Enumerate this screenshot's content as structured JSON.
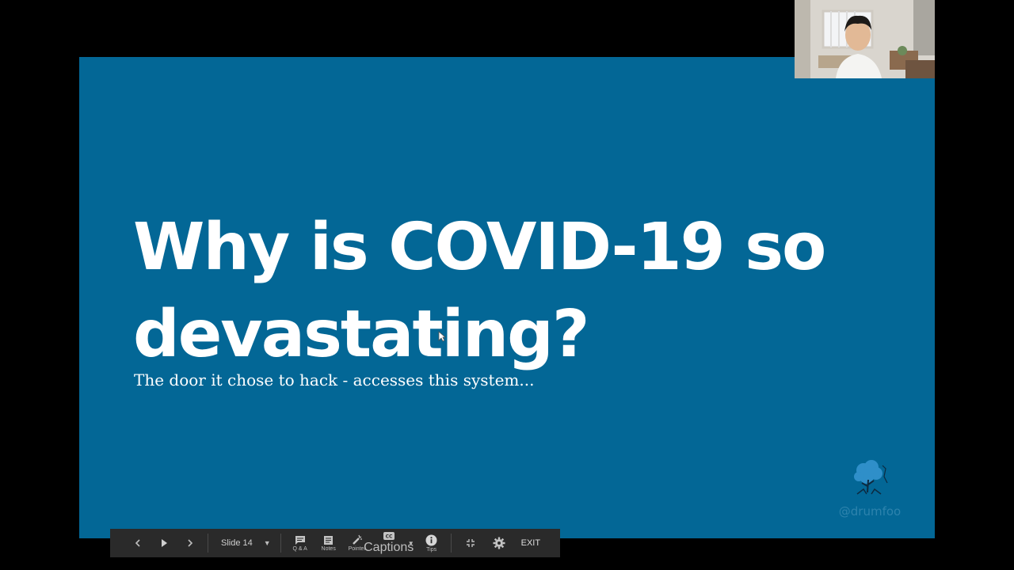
{
  "slide": {
    "title_line1": "Why is COVID-19 so",
    "title_line2": "devastating?",
    "subtitle": "The door it chose to hack - accesses this system...",
    "handle": "@drumfoo",
    "background_color": "#036796"
  },
  "toolbar": {
    "slide_label": "Slide 14",
    "qa_label": "Q & A",
    "notes_label": "Notes",
    "pointer_label": "Pointer",
    "captions_label": "Captions",
    "tips_label": "Tips",
    "exit_label": "EXIT"
  },
  "icons": {
    "prev": "chevron-left-icon",
    "play": "play-icon",
    "next": "chevron-right-icon",
    "qa": "chat-icon",
    "notes": "notes-icon",
    "pointer": "laser-pointer-icon",
    "captions": "cc-icon",
    "tips": "info-icon",
    "exit_fullscreen": "collapse-icon",
    "settings": "gear-icon"
  }
}
